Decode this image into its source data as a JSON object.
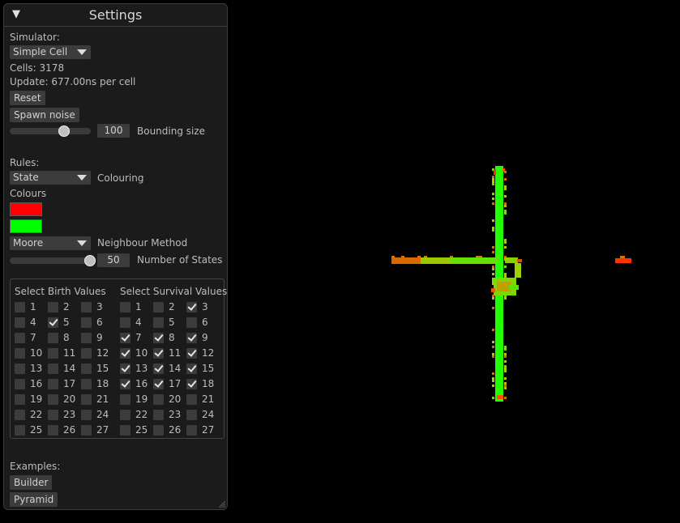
{
  "window": {
    "title": "Settings",
    "collapse_icon": "triangle-down-icon"
  },
  "simulator": {
    "label": "Simulator:",
    "selected": "Simple Cell",
    "cells": "Cells: 3178",
    "update": "Update: 677.00ns per cell",
    "reset_label": "Reset",
    "spawn_noise_label": "Spawn noise",
    "bounding_size_value": "100",
    "bounding_size_label": "Bounding size",
    "bounding_size_fraction": 0.65
  },
  "rules": {
    "label": "Rules:",
    "colouring_selected": "State",
    "colouring_label": "Colouring",
    "colours_label": "Colours",
    "colour1": "#ff0000",
    "colour2": "#00ff00",
    "neighbour_selected": "Moore",
    "neighbour_label": "Neighbour Method",
    "states_value": "50",
    "states_label": "Number of States",
    "states_fraction": 0.99,
    "birth_header": "Select Birth Values",
    "survival_header": "Select Survival Values",
    "birth": [
      {
        "n": "1",
        "c": false
      },
      {
        "n": "2",
        "c": false
      },
      {
        "n": "3",
        "c": false
      },
      {
        "n": "4",
        "c": false
      },
      {
        "n": "5",
        "c": true
      },
      {
        "n": "6",
        "c": false
      },
      {
        "n": "7",
        "c": false
      },
      {
        "n": "8",
        "c": false
      },
      {
        "n": "9",
        "c": false
      },
      {
        "n": "10",
        "c": false
      },
      {
        "n": "11",
        "c": false
      },
      {
        "n": "12",
        "c": false
      },
      {
        "n": "13",
        "c": false
      },
      {
        "n": "14",
        "c": false
      },
      {
        "n": "15",
        "c": false
      },
      {
        "n": "16",
        "c": false
      },
      {
        "n": "17",
        "c": false
      },
      {
        "n": "18",
        "c": false
      },
      {
        "n": "19",
        "c": false
      },
      {
        "n": "20",
        "c": false
      },
      {
        "n": "21",
        "c": false
      },
      {
        "n": "22",
        "c": false
      },
      {
        "n": "23",
        "c": false
      },
      {
        "n": "24",
        "c": false
      },
      {
        "n": "25",
        "c": false
      },
      {
        "n": "26",
        "c": false
      },
      {
        "n": "27",
        "c": false
      }
    ],
    "survival": [
      {
        "n": "1",
        "c": false
      },
      {
        "n": "2",
        "c": false
      },
      {
        "n": "3",
        "c": true
      },
      {
        "n": "4",
        "c": false
      },
      {
        "n": "5",
        "c": false
      },
      {
        "n": "6",
        "c": false
      },
      {
        "n": "7",
        "c": true
      },
      {
        "n": "8",
        "c": true
      },
      {
        "n": "9",
        "c": true
      },
      {
        "n": "10",
        "c": true
      },
      {
        "n": "11",
        "c": true
      },
      {
        "n": "12",
        "c": true
      },
      {
        "n": "13",
        "c": true
      },
      {
        "n": "14",
        "c": true
      },
      {
        "n": "15",
        "c": true
      },
      {
        "n": "16",
        "c": true
      },
      {
        "n": "17",
        "c": true
      },
      {
        "n": "18",
        "c": true
      },
      {
        "n": "19",
        "c": false
      },
      {
        "n": "20",
        "c": false
      },
      {
        "n": "21",
        "c": false
      },
      {
        "n": "22",
        "c": false
      },
      {
        "n": "23",
        "c": false
      },
      {
        "n": "24",
        "c": false
      },
      {
        "n": "25",
        "c": false
      },
      {
        "n": "26",
        "c": false
      },
      {
        "n": "27",
        "c": false
      }
    ]
  },
  "examples": {
    "label": "Examples:",
    "builder_label": "Builder",
    "pyramid_label": "Pyramid"
  }
}
